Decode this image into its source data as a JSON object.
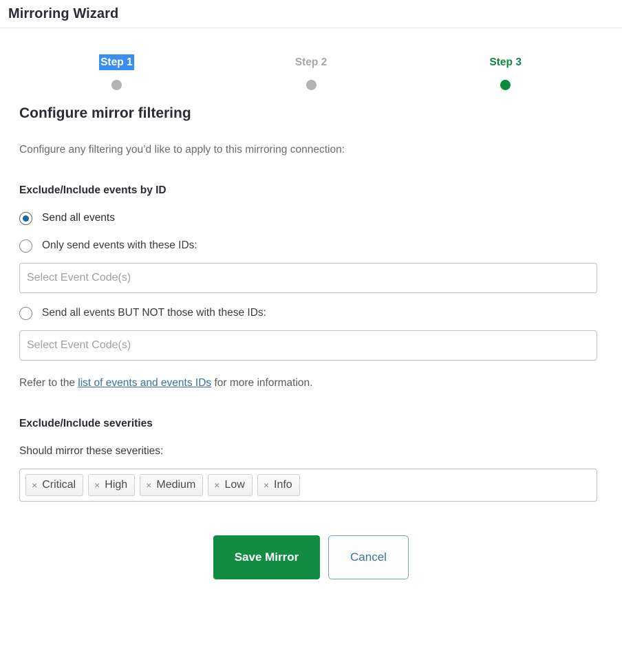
{
  "window": {
    "title": "Mirroring Wizard"
  },
  "stepper": {
    "steps": [
      {
        "label": "Step 1",
        "state": "selected"
      },
      {
        "label": "Step 2",
        "state": "inactive"
      },
      {
        "label": "Step 3",
        "state": "active"
      }
    ],
    "active_color": "#0e8a3e",
    "inactive_color": "#b3b3b3",
    "selection_highlight_color": "#3a8ef0"
  },
  "main": {
    "section_title": "Configure mirror filtering",
    "intro": "Configure any filtering you’d like to apply to this mirroring connection:",
    "events_by_id": {
      "heading": "Exclude/Include events by ID",
      "options": [
        {
          "label": "Send all events",
          "checked": true
        },
        {
          "label": "Only send events with these IDs:",
          "checked": false
        },
        {
          "label": "Send all events BUT NOT those with these IDs:",
          "checked": false
        }
      ],
      "include_input_placeholder": "Select Event Code(s)",
      "exclude_input_placeholder": "Select Event Code(s)",
      "refer_prefix": "Refer to the ",
      "refer_link": "list of events and events IDs",
      "refer_suffix": " for more information."
    },
    "severities": {
      "heading": "Exclude/Include severities",
      "label": "Should mirror these severities:",
      "chips": [
        {
          "label": "Critical",
          "remove_icon": "×"
        },
        {
          "label": "High",
          "remove_icon": "×"
        },
        {
          "label": "Medium",
          "remove_icon": "×"
        },
        {
          "label": "Low",
          "remove_icon": "×"
        },
        {
          "label": "Info",
          "remove_icon": "×"
        }
      ]
    }
  },
  "footer": {
    "save_label": "Save Mirror",
    "cancel_label": "Cancel",
    "save_color": "#118c42",
    "cancel_text_color": "#3f6f9f"
  }
}
